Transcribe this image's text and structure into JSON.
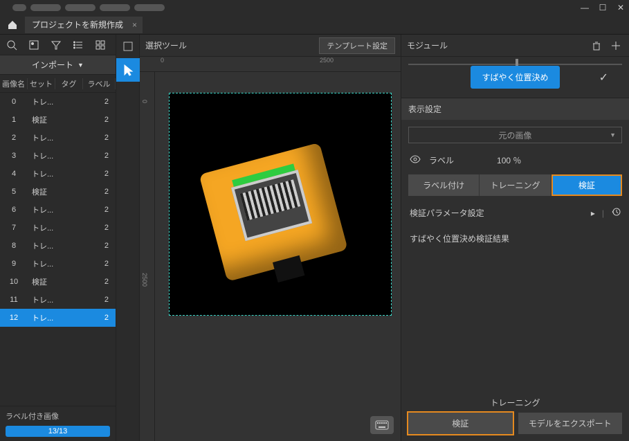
{
  "window": {
    "minimize": "—",
    "maximize": "☐",
    "close": "✕"
  },
  "project_tab": {
    "label": "プロジェクトを新規作成",
    "close": "×"
  },
  "left": {
    "import": "インポート",
    "headers": {
      "idx": "画像名",
      "set": "セット",
      "tag": "タグ",
      "label": "ラベル"
    },
    "rows": [
      {
        "idx": "0",
        "set": "トレ...",
        "label": "2"
      },
      {
        "idx": "1",
        "set": "検証",
        "label": "2"
      },
      {
        "idx": "2",
        "set": "トレ...",
        "label": "2"
      },
      {
        "idx": "3",
        "set": "トレ...",
        "label": "2"
      },
      {
        "idx": "4",
        "set": "トレ...",
        "label": "2"
      },
      {
        "idx": "5",
        "set": "検証",
        "label": "2"
      },
      {
        "idx": "6",
        "set": "トレ...",
        "label": "2"
      },
      {
        "idx": "7",
        "set": "トレ...",
        "label": "2"
      },
      {
        "idx": "8",
        "set": "トレ...",
        "label": "2"
      },
      {
        "idx": "9",
        "set": "トレ...",
        "label": "2"
      },
      {
        "idx": "10",
        "set": "検証",
        "label": "2"
      },
      {
        "idx": "11",
        "set": "トレ...",
        "label": "2"
      },
      {
        "idx": "12",
        "set": "トレ...",
        "label": "2"
      }
    ],
    "footer_label": "ラベル付き画像",
    "progress": "13/13"
  },
  "canvas": {
    "title": "選択ツール",
    "template_btn": "テンプレート設定",
    "ruler_top": {
      "t0": "0",
      "t2500": "2500"
    },
    "ruler_left": {
      "v0": "0",
      "v2500": "2500"
    }
  },
  "right": {
    "title": "モジュール",
    "quick_btn": "すばやく位置決め",
    "display_section": "表示設定",
    "orig_select": "元の画像",
    "label_text": "ラベル",
    "pct": "100 ％",
    "seg": {
      "label": "ラベル付け",
      "train": "トレーニング",
      "verify": "検証"
    },
    "param": "検証パラメータ設定",
    "result": "すばやく位置決め検証結果",
    "bottom_train": "トレーニング",
    "bottom": {
      "verify": "検証",
      "export": "モデルをエクスポート"
    }
  }
}
